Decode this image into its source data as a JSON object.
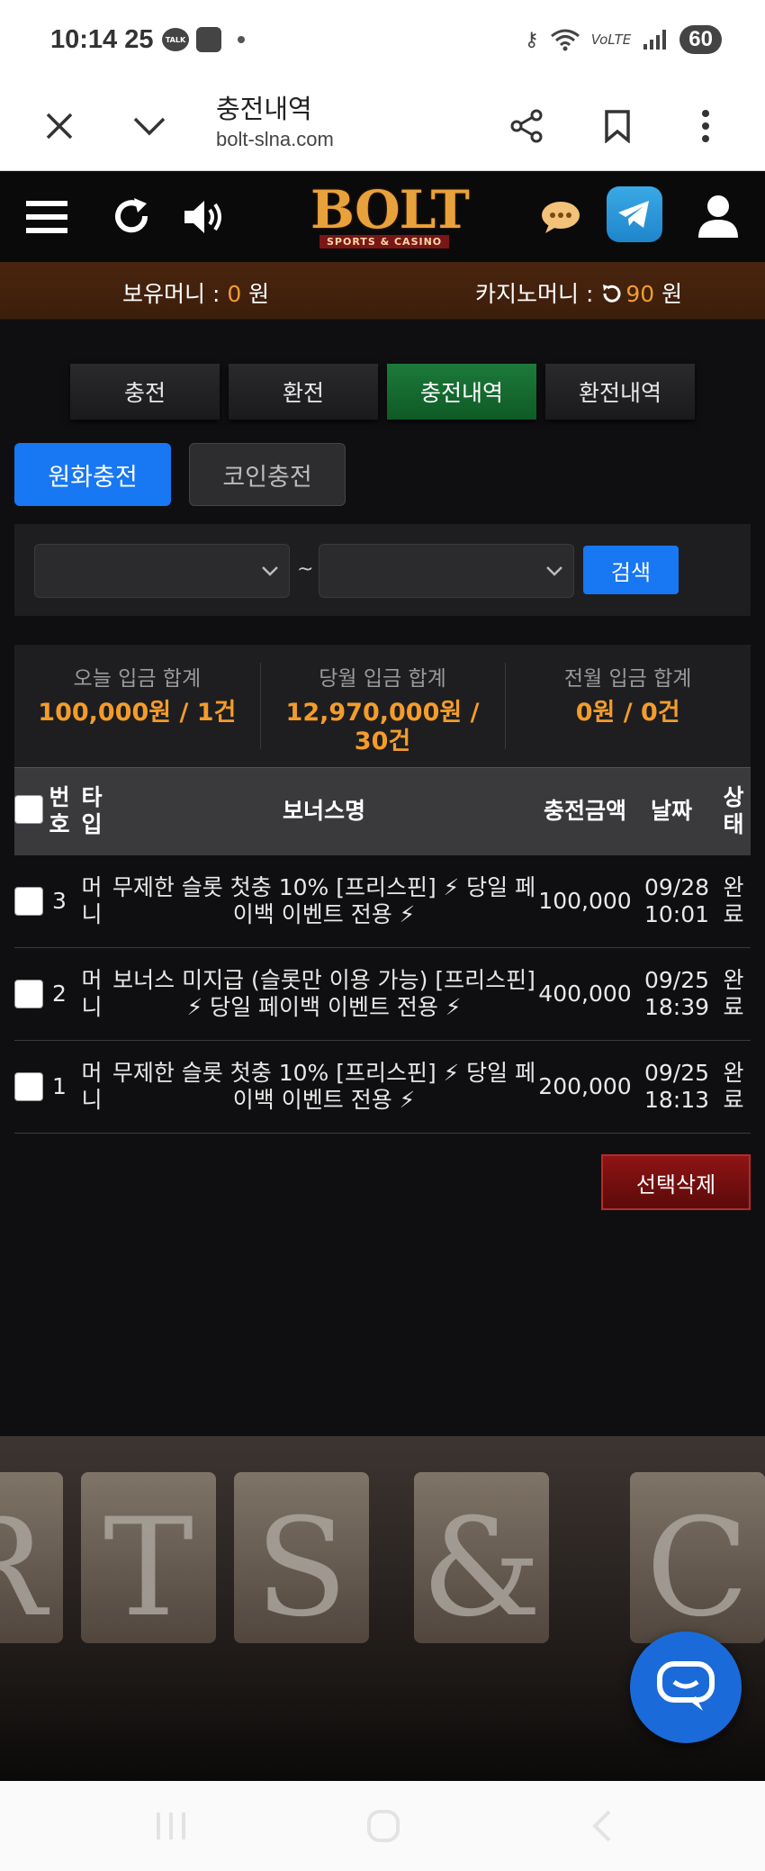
{
  "status_bar": {
    "time": "10:14",
    "date": "25",
    "talk_label": "TALK",
    "battery": "60"
  },
  "browser": {
    "title": "충전내역",
    "url": "bolt-slna.com"
  },
  "header": {
    "logo_text": "BOLT",
    "logo_sub": "SPORTS & CASINO"
  },
  "money": {
    "holding_label": "보유머니 : ",
    "holding_value": "0",
    "holding_unit": " 원",
    "casino_label": "카지노머니 : ",
    "casino_value": "90",
    "casino_unit": " 원"
  },
  "tabs": [
    {
      "label": "충전",
      "active": false
    },
    {
      "label": "환전",
      "active": false
    },
    {
      "label": "충전내역",
      "active": true
    },
    {
      "label": "환전내역",
      "active": false
    }
  ],
  "subtabs": [
    {
      "label": "원화충전",
      "active": true
    },
    {
      "label": "코인충전",
      "active": false
    }
  ],
  "search": {
    "tilde": "~",
    "button": "검색",
    "from_value": "",
    "to_value": ""
  },
  "summary": [
    {
      "label": "오늘 입금 합계",
      "value": "100,000원 / 1건"
    },
    {
      "label": "당월 입금 합계",
      "value": "12,970,000원 / 30건"
    },
    {
      "label": "전월 입금 합계",
      "value": "0원 / 0건"
    }
  ],
  "table": {
    "headers": {
      "number": "번호",
      "type": "타입",
      "bonus": "보너스명",
      "amount": "충전금액",
      "date": "날짜",
      "status": "상태"
    },
    "rows": [
      {
        "no": "3",
        "type": "머니",
        "bonus": "무제한 슬롯 첫충 10% [프리스핀] ⚡ 당일 페이백 이벤트 전용 ⚡",
        "amount": "100,000",
        "date": "09/28 10:01",
        "status": "완료"
      },
      {
        "no": "2",
        "type": "머니",
        "bonus": "보너스 미지급 (슬롯만 이용 가능) [프리스핀] ⚡ 당일 페이백 이벤트 전용 ⚡",
        "amount": "400,000",
        "date": "09/25 18:39",
        "status": "완료"
      },
      {
        "no": "1",
        "type": "머니",
        "bonus": "무제한 슬롯 첫충 10% [프리스핀] ⚡ 당일 페이백 이벤트 전용 ⚡",
        "amount": "200,000",
        "date": "09/25 18:13",
        "status": "완료"
      }
    ]
  },
  "delete_button": "선택삭제",
  "banner": {
    "letters": [
      "R",
      "T",
      "S",
      "&",
      "C"
    ]
  },
  "colors": {
    "accent_blue": "#1877f2",
    "accent_orange": "#f39c2b",
    "active_green": "#1c7a3a",
    "delete_red": "#8e1414"
  }
}
